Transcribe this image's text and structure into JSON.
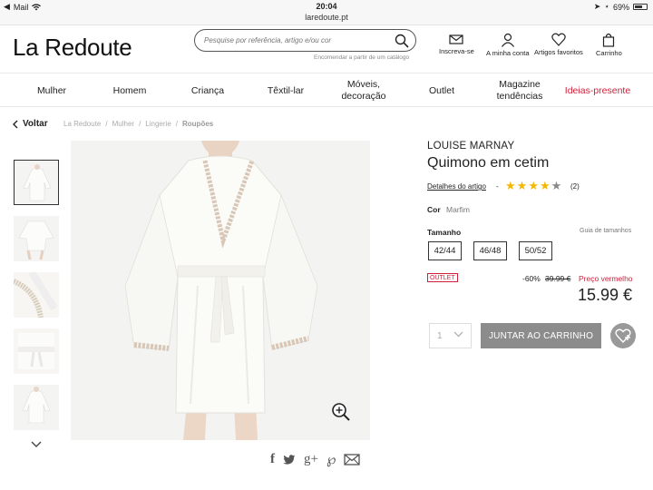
{
  "status_bar": {
    "carrier": "Mail",
    "time": "20:04",
    "battery": "69%",
    "battery_level": 0.69
  },
  "url": "laredoute.pt",
  "header": {
    "logo": "La Redoute",
    "search_placeholder": "Pesquise por referência, artigo e/ou cor",
    "catalog_link": "Encomendar a partir de um catálogo",
    "register": "Inscreva-se",
    "account": "A minha conta",
    "favorites": "Artigos favoritos",
    "cart": "Carrinho"
  },
  "nav": {
    "items": [
      "Mulher",
      "Homem",
      "Criança",
      "Têxtil-lar",
      "Móveis, decoração",
      "Outlet",
      "Magazine tendências",
      "Ideias-presente"
    ]
  },
  "breadcrumb": {
    "back": "Voltar",
    "items": [
      "La Redoute",
      "Mulher",
      "Lingerie",
      "Roupões"
    ],
    "separator": "/"
  },
  "product": {
    "brand": "LOUISE MARNAY",
    "title": "Quimono em cetim",
    "details_link": "Detalhes do artigo",
    "dash": "-",
    "rating": 4,
    "rating_max": 5,
    "review_count": "(2)",
    "color_label": "Cor",
    "color_value": "Marfim",
    "size_label": "Tamanho",
    "size_guide": "Guia de tamanhos",
    "sizes": [
      "42/44",
      "46/48",
      "50/52"
    ],
    "outlet_badge": "OUTLET",
    "discount": "-60%",
    "old_price": "39.99 €",
    "red_price_label": "Preço vermelho",
    "price": "15.99 €",
    "quantity": "1",
    "add_to_cart": "JUNTAR AO CARRINHO"
  },
  "colors": {
    "accent_red": "#d0213b",
    "button_gray": "#8c8c8c",
    "star": "#f5b800"
  }
}
